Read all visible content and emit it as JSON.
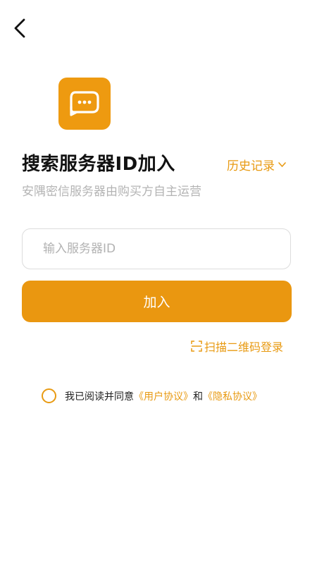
{
  "icons": {
    "back": "chevron-left-icon",
    "logo": "chat-bubble-icon",
    "history_chevron": "chevron-down-icon",
    "scan": "scan-icon"
  },
  "colors": {
    "accent": "#EA9710",
    "subtitle": "#B4B4B4"
  },
  "header": {
    "title": "搜索服务器ID加入",
    "history_label": "历史记录",
    "subtitle": "安隅密信服务器由购买方自主运营"
  },
  "form": {
    "server_id_placeholder": "输入服务器ID",
    "server_id_value": "",
    "join_label": "加入",
    "scan_label": "扫描二维码登录"
  },
  "agreement": {
    "prefix": "我已阅读并同意",
    "user_agreement": "《用户协议》",
    "conjunction": "和",
    "privacy_agreement": "《隐私协议》",
    "checked": false
  }
}
